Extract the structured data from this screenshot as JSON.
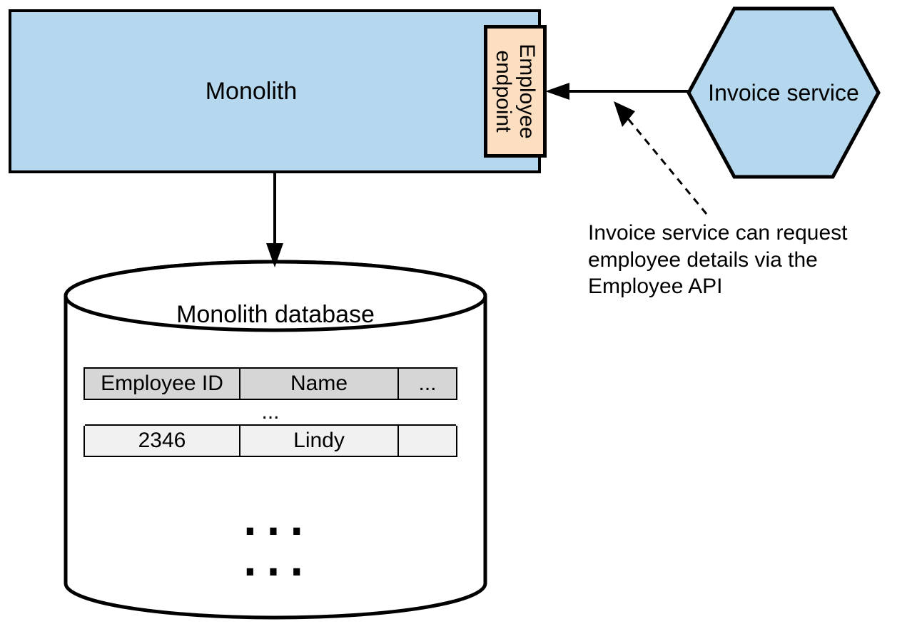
{
  "monolith": {
    "label": "Monolith"
  },
  "endpoint": {
    "line1": "Employee",
    "line2": "endpoint"
  },
  "invoice": {
    "label": "Invoice service"
  },
  "database": {
    "label": "Monolith database",
    "headers": [
      "Employee ID",
      "Name",
      "..."
    ],
    "gap_label": "...",
    "row": [
      "2346",
      "Lindy",
      ""
    ],
    "dots": "...",
    "dots2": "..."
  },
  "annotation": {
    "line1": "Invoice service can request",
    "line2": "employee details via the",
    "line3": "Employee API"
  }
}
